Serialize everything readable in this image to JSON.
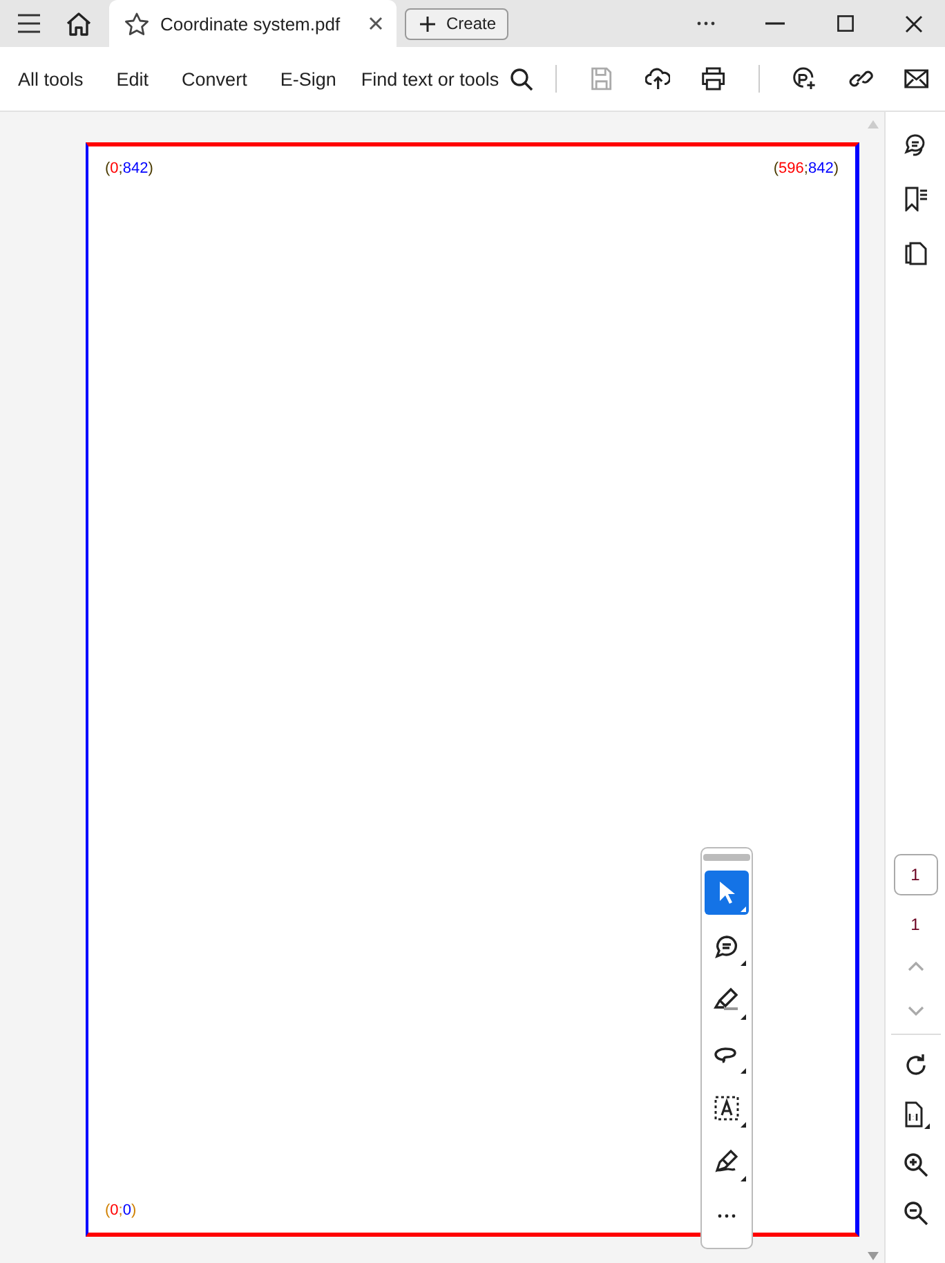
{
  "tab_bar": {
    "tab": {
      "title": "Coordinate system.pdf",
      "selected": true
    },
    "create_button": "Create"
  },
  "toolbar": {
    "menus": [
      "All tools",
      "Edit",
      "Convert",
      "E-Sign"
    ],
    "search_label": "Find text or tools",
    "actions": [
      {
        "kind": "save",
        "disabled": true
      },
      {
        "kind": "upload",
        "disabled": false
      },
      {
        "kind": "print",
        "disabled": false
      },
      {
        "kind": "share",
        "disabled": false
      },
      {
        "kind": "link",
        "disabled": false
      },
      {
        "kind": "mail",
        "disabled": false
      }
    ]
  },
  "document": {
    "top_left": [
      {
        "text": "(",
        "color": "#4a3a00"
      },
      {
        "text": "0",
        "color": "#ff0000"
      },
      {
        "text": ";",
        "color": "#4a3a00"
      },
      {
        "text": "842",
        "color": "#0000ff"
      },
      {
        "text": ")",
        "color": "#4a3a00"
      }
    ],
    "top_right": [
      {
        "text": "(",
        "color": "#4a3a00"
      },
      {
        "text": "596",
        "color": "#ff0000"
      },
      {
        "text": ";",
        "color": "#4a3a00"
      },
      {
        "text": "842",
        "color": "#0000ff"
      },
      {
        "text": ")",
        "color": "#4a3a00"
      }
    ],
    "bottom_left": [
      {
        "text": "(",
        "color": "#d08000"
      },
      {
        "text": "0",
        "color": "#ff0000"
      },
      {
        "text": ";",
        "color": "#d08000"
      },
      {
        "text": "0",
        "color": "#0000ff"
      },
      {
        "text": ")",
        "color": "#d08000"
      }
    ]
  },
  "floating_tools": [
    {
      "kind": "select",
      "selected": true
    },
    {
      "kind": "comment",
      "selected": false
    },
    {
      "kind": "highlight",
      "selected": false
    },
    {
      "kind": "draw",
      "selected": false
    },
    {
      "kind": "text_select",
      "selected": false
    },
    {
      "kind": "sign",
      "selected": false
    },
    {
      "kind": "more",
      "selected": false
    }
  ],
  "right_rail": {
    "page_input": "1",
    "page_total": "1"
  }
}
